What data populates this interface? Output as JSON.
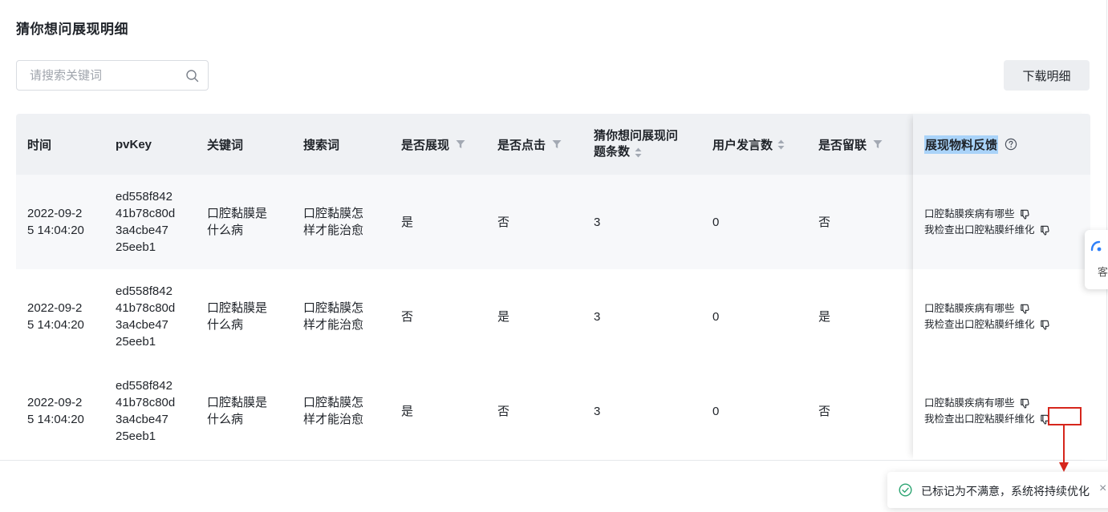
{
  "page": {
    "title": "猜你想问展现明细"
  },
  "search": {
    "placeholder": "请搜索关键词",
    "value": ""
  },
  "toolbar": {
    "download_label": "下载明细"
  },
  "table": {
    "headers": {
      "time": "时间",
      "pvkey": "pvKey",
      "keyword": "关键词",
      "search_term": "搜索词",
      "shown": "是否展现",
      "clicked": "是否点击",
      "question_count_1": "猜你想问展现问",
      "question_count_2": "题条数",
      "user_msgs": "用户发言数",
      "contact": "是否留联",
      "feedback": "展现物料反馈"
    },
    "rows": [
      {
        "time": "2022-09-2\n5 14:04:20",
        "pvkey": "ed558f842\n41b78c80d\n3a4cbe47\n25eeb1",
        "keyword": "口腔黏膜是\n什么病",
        "search_term": "口腔黏膜怎\n样才能治愈",
        "shown": "是",
        "clicked": "否",
        "question_count": "3",
        "user_msgs": "0",
        "contact": "否",
        "feedback": [
          "口腔黏膜疾病有哪些",
          "我检查出口腔粘膜纤维化"
        ]
      },
      {
        "time": "2022-09-2\n5 14:04:20",
        "pvkey": "ed558f842\n41b78c80d\n3a4cbe47\n25eeb1",
        "keyword": "口腔黏膜是\n什么病",
        "search_term": "口腔黏膜怎\n样才能治愈",
        "shown": "否",
        "clicked": "是",
        "question_count": "3",
        "user_msgs": "0",
        "contact": "是",
        "feedback": [
          "口腔黏膜疾病有哪些",
          "我检查出口腔粘膜纤维化"
        ]
      },
      {
        "time": "2022-09-2\n5 14:04:20",
        "pvkey": "ed558f842\n41b78c80d\n3a4cbe47\n25eeb1",
        "keyword": "口腔黏膜是\n什么病",
        "search_term": "口腔黏膜怎\n样才能治愈",
        "shown": "是",
        "clicked": "否",
        "question_count": "3",
        "user_msgs": "0",
        "contact": "否",
        "feedback": [
          "口腔黏膜疾病有哪些",
          "我检查出口腔粘膜纤维化"
        ]
      }
    ]
  },
  "side_widget": {
    "label": "客"
  },
  "toast": {
    "message": "已标记为不满意，系统将持续优化",
    "close": "×"
  },
  "colors": {
    "header_bg": "#eff1f4",
    "alt_row_bg": "#f7f8fa",
    "highlight": "#a9d3f9",
    "annotation_red": "#d6261c",
    "success_green": "#2ba471",
    "accent_blue": "#2d7ff9"
  },
  "icons": {
    "search": "search-icon",
    "filter": "filter-icon",
    "sort": "sort-icon",
    "help": "help-circle-icon",
    "dislike": "thumbs-down-icon",
    "success": "check-circle-icon",
    "close": "close-icon"
  }
}
